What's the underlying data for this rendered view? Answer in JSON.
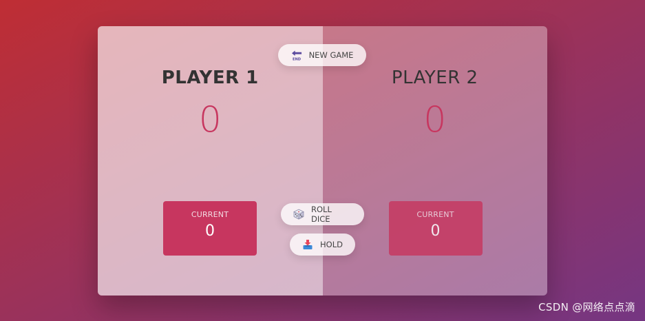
{
  "players": [
    {
      "name": "PLAYER 1",
      "score": "0",
      "current_label": "CURRENT",
      "current_score": "0"
    },
    {
      "name": "PLAYER 2",
      "score": "0",
      "current_label": "CURRENT",
      "current_score": "0"
    }
  ],
  "buttons": {
    "new_game": {
      "label": "NEW GAME",
      "icon": "end-arrow-icon"
    },
    "roll_dice": {
      "label": "ROLL DICE",
      "icon": "dice-icon"
    },
    "hold": {
      "label": "HOLD",
      "icon": "inbox-tray-icon"
    }
  },
  "watermark": "CSDN @网络点点滴",
  "colors": {
    "accent": "#c7365f",
    "gradient_start": "#bf2e34",
    "gradient_end": "#753682"
  }
}
